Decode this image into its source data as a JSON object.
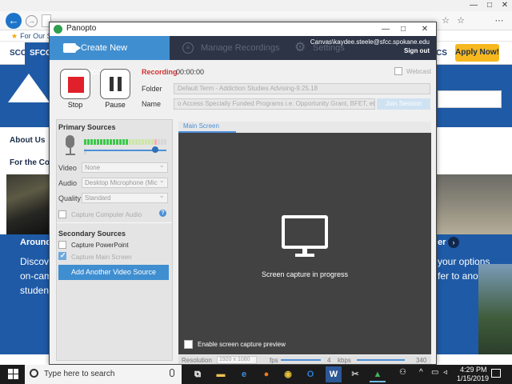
{
  "browser": {
    "favorites_bar_item": "For Our Stu",
    "minimize": "—",
    "restore": "□",
    "close": "✕",
    "back_glyph": "←",
    "forward_glyph": "→",
    "star_glyph": "☆",
    "favorites_glyph": "☆",
    "settings_glyph": "⋯"
  },
  "website": {
    "nav_tabs": [
      "SCC",
      "SFCC"
    ],
    "nav_right_fragment": "CS",
    "apply_button": "Apply Now!",
    "sidebar_about": "About Us",
    "sidebar_for_the": "For the Con",
    "around_title": "Around",
    "around_lines": [
      "Discove",
      "on-cam",
      "studen"
    ],
    "right_fragment_title": "er",
    "right_lines": [
      "your options",
      "fer to another"
    ],
    "right_arrow_glyph": "›"
  },
  "panopto": {
    "window_title": "Panopto",
    "window_controls": {
      "minimize": "—",
      "maximize": "□",
      "close": "✕"
    },
    "tabs": {
      "create": "Create New Recording",
      "manage": "Manage Recordings",
      "settings": "Settings"
    },
    "user_email": "Canvas\\kaydee.steele@sfcc.spokane.edu",
    "sign_out": "Sign out",
    "stop_label": "Stop",
    "pause_label": "Pause",
    "recording_status": "Recording",
    "recording_time": "00:00:00",
    "webcast_label": "Webcast",
    "folder_label": "Folder",
    "folder_value": "Default Term - Addiction Studies Advising-9.25.18",
    "name_label": "Name",
    "name_value": "o Access Specially Funded Programs i.e. Opportunity Grant, BFET, etc",
    "join_session": "Join Session",
    "primary_sources": "Primary Sources",
    "video_label": "Video",
    "video_value": "None",
    "audio_label": "Audio",
    "audio_value": "Desktop Microphone (Mic",
    "quality_label": "Quality",
    "quality_value": "Standard",
    "capture_computer_audio": "Capture Computer Audio",
    "secondary_sources": "Secondary Sources",
    "capture_powerpoint": "Capture PowerPoint",
    "capture_main_screen": "Capture Main Screen",
    "add_video_source": "Add Another Video Source",
    "preview_tab": "Main Screen",
    "capture_status": "Screen capture in progress",
    "enable_preview": "Enable screen capture preview",
    "resolution_label": "Resolution",
    "resolution_value": "1920 x 1080",
    "fps_label": "fps",
    "fps_value": "4",
    "kbps_label": "kbps",
    "kbps_value": "340",
    "audio_level_fraction": 0.85,
    "colors": {
      "accent": "#3f8ed0",
      "record": "#e0202a",
      "tabbar": "#2c3446"
    }
  },
  "taskbar": {
    "search_placeholder": "Type here to search",
    "apps": [
      "task-view",
      "edge",
      "file-explorer",
      "firefox",
      "chrome",
      "outlook",
      "word",
      "snipping-tool",
      "panopto"
    ],
    "clock_time": "4:29 PM",
    "clock_date": "1/15/2019"
  }
}
